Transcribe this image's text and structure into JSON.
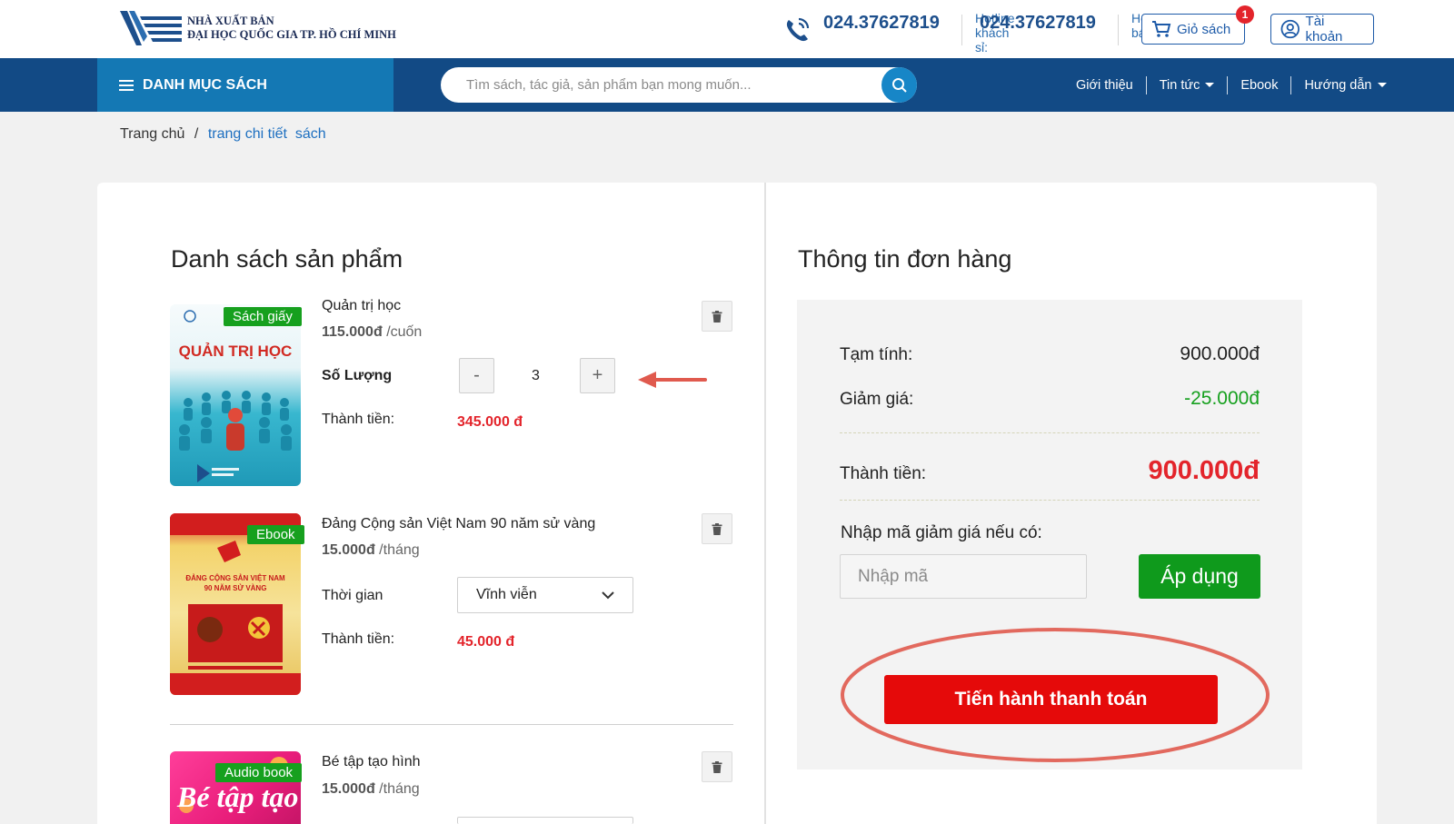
{
  "header": {
    "publisher_line1": "NHÀ XUẤT BẢN",
    "publisher_line2": "ĐẠI HỌC QUỐC GIA TP. HỒ CHÍ MINH",
    "hotline_wholesale_label": "Hotline khách sỉ:",
    "hotline_wholesale_number": "024.37627819",
    "hotline_retail_label": "Hotline bán lẻ:",
    "hotline_retail_number": "024.37627819",
    "cart_label": "Giỏ sách",
    "cart_count": "1",
    "account_label": "Tài khoản"
  },
  "nav": {
    "categories_label": "DANH MỤC SÁCH",
    "search_placeholder": "Tìm sách, tác giả, sản phẩm bạn mong muốn...",
    "menu": [
      "Giới thiệu",
      "Tin tức",
      "Ebook",
      "Hướng dẫn"
    ]
  },
  "breadcrumb": {
    "home": "Trang chủ",
    "separator": "/",
    "current": "trang chi tiết  sách"
  },
  "product_list": {
    "title": "Danh sách sản phẩm",
    "items": [
      {
        "tag": "Sách giấy",
        "cover_title": "QUẢN TRỊ HỌC",
        "name": "Quản trị học",
        "price": "115.000đ",
        "unit": "/cuốn",
        "option_label": "Số Lượng",
        "quantity": "3",
        "minus": "-",
        "plus": "+",
        "total_label": "Thành tiền:",
        "total": "345.000 đ"
      },
      {
        "tag": "Ebook",
        "cover_title": "ĐẢNG CỘNG SẢN VIỆT NAM 90 NĂM SỬ VÀNG",
        "name": "Đảng Cộng sản Việt Nam 90 năm sử vàng",
        "price": "15.000đ",
        "unit": "/tháng",
        "option_label": "Thời gian",
        "duration": "Vĩnh viễn",
        "total_label": "Thành tiền:",
        "total": "45.000 đ"
      },
      {
        "tag": "Audio book",
        "cover_title": "Bé tập tạo hình",
        "name": "Bé tập tạo hình",
        "price": "15.000đ",
        "unit": "/tháng"
      }
    ]
  },
  "order": {
    "title": "Thông tin đơn hàng",
    "subtotal_label": "Tạm tính:",
    "subtotal": "900.000đ",
    "discount_label": "Giảm giá:",
    "discount": "-25.000đ",
    "total_label": "Thành tiền:",
    "total": "900.000đ",
    "coupon_prompt": "Nhập mã giảm giá nếu có:",
    "coupon_placeholder": "Nhập mã",
    "apply_label": "Áp dụng",
    "checkout_label": "Tiến hành thanh toán"
  },
  "colors": {
    "nav_bg": "#124a85",
    "categories_bg": "#1478b4",
    "price_red": "#e3242b",
    "discount_green": "#16a01e",
    "apply_green": "#0f9a1c",
    "checkout_red": "#e50a0a",
    "annotation_red": "#e05a4e"
  }
}
